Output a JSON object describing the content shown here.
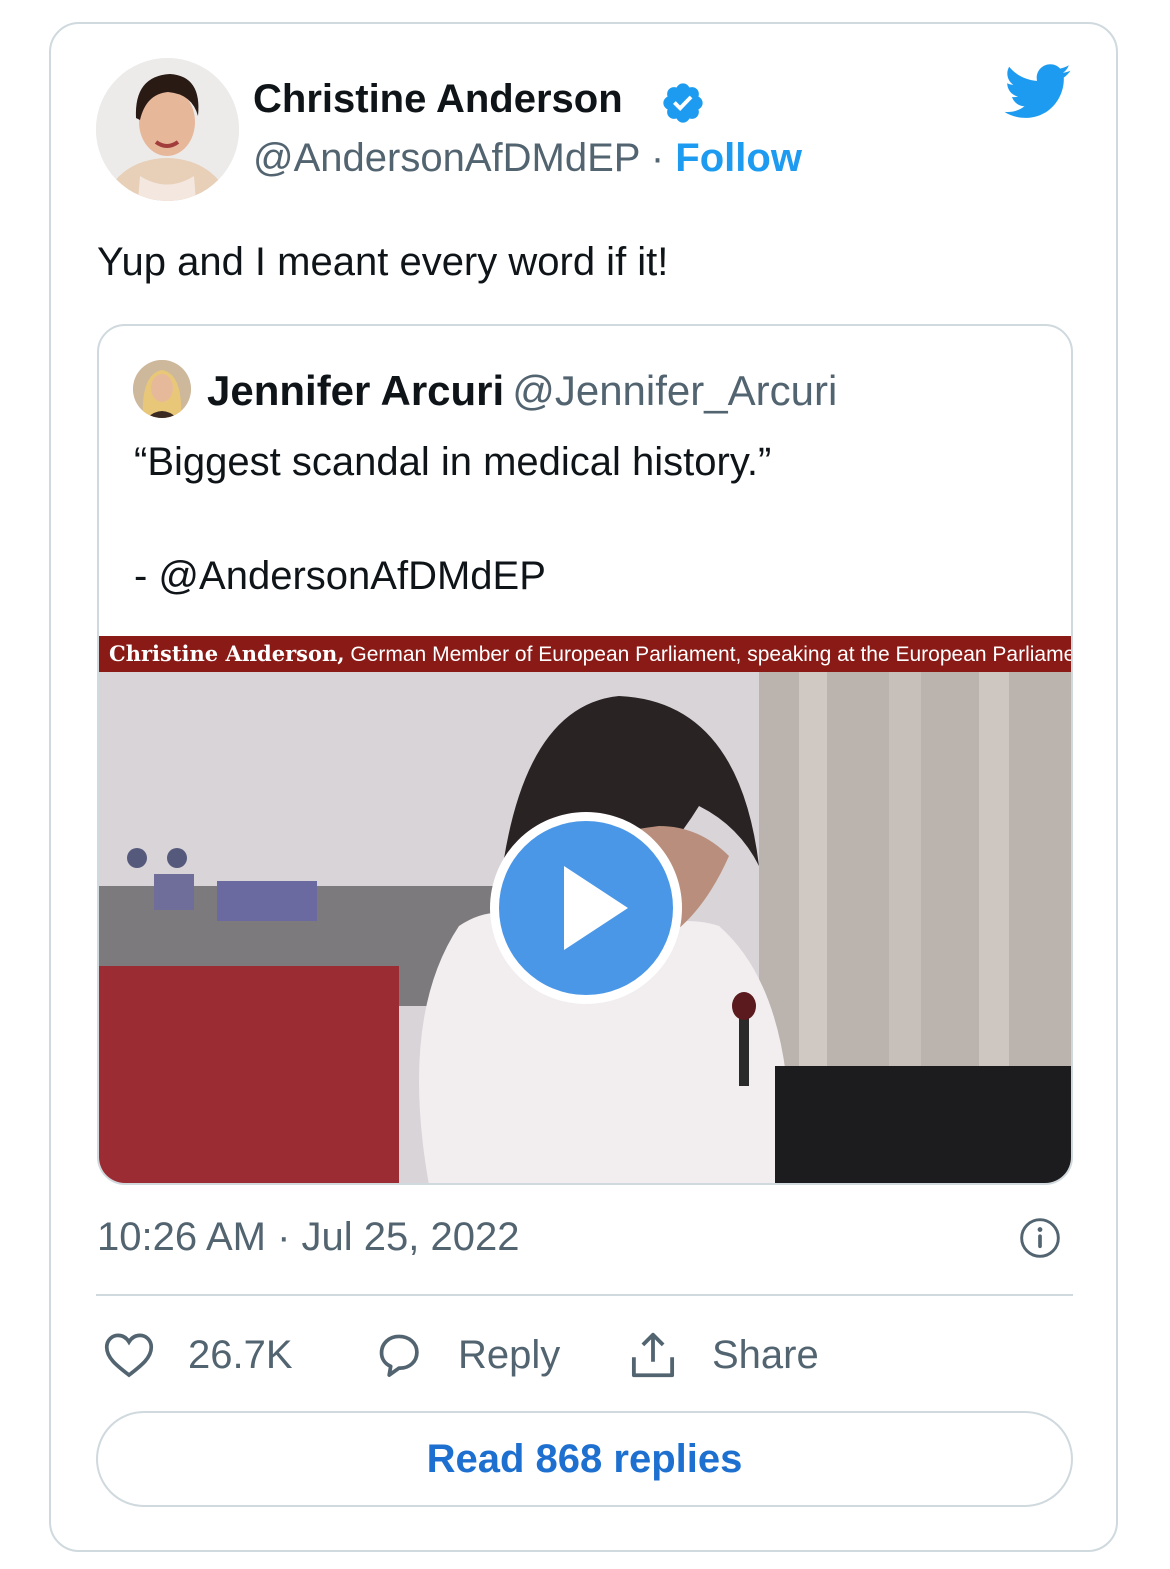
{
  "author": {
    "name": "Christine Anderson",
    "handle": "@AndersonAfDMdEP",
    "separator": "·",
    "follow_label": "Follow",
    "avatar_icon": "profile-photo",
    "verified_icon": "verified-badge-icon"
  },
  "tweet": {
    "text": "Yup and I meant every word if it!",
    "timestamp": "10:26 AM · Jul 25, 2022"
  },
  "quoted_tweet": {
    "name": "Jennifer Arcuri",
    "handle": "@Jennifer_Arcuri",
    "text": "“Biggest scandal in medical history.”\n\n- @AndersonAfDMdEP",
    "video": {
      "caption_bold": "Christine Anderson,",
      "caption_rest": " German Member of European Parliament, speaking at the European Parliament"
    }
  },
  "actions": {
    "like_count": "26.7K",
    "reply_label": "Reply",
    "share_label": "Share"
  },
  "read_replies_label": "Read 868 replies",
  "colors": {
    "accent": "#1d9bf0",
    "text": "#0f1419",
    "muted": "#536471",
    "border": "#cfd9de",
    "caption_bar": "#8a1a16"
  }
}
